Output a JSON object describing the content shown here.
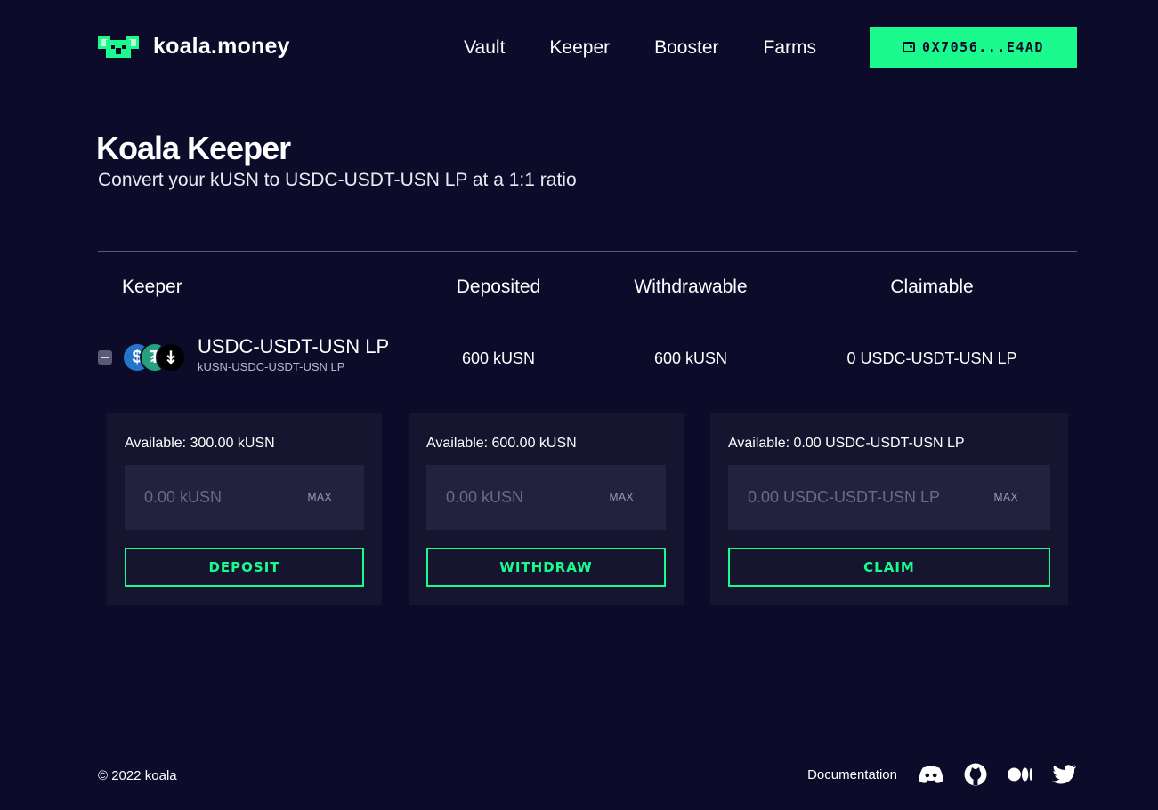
{
  "header": {
    "logo_text": "koala.money",
    "nav": [
      "Vault",
      "Keeper",
      "Booster",
      "Farms"
    ],
    "wallet_label": "0X7056...E4AD"
  },
  "page": {
    "title": "Koala Keeper",
    "subtitle": "Convert your kUSN to USDC-USDT-USN LP at a 1:1 ratio"
  },
  "table": {
    "headers": [
      "Keeper",
      "Deposited",
      "Withdrawable",
      "Claimable"
    ],
    "row": {
      "name": "USDC-USDT-USN LP",
      "subname": "kUSN-USDC-USDT-USN LP",
      "deposited": "600 kUSN",
      "withdrawable": "600 kUSN",
      "claimable": "0 USDC-USDT-USN LP"
    }
  },
  "panels": [
    {
      "available": "Available: 300.00 kUSN",
      "placeholder": "0.00 kUSN",
      "max_label": "MAX",
      "action_label": "DEPOSIT"
    },
    {
      "available": "Available: 600.00 kUSN",
      "placeholder": "0.00 kUSN",
      "max_label": "MAX",
      "action_label": "WITHDRAW"
    },
    {
      "available": "Available: 0.00 USDC-USDT-USN LP",
      "placeholder": "0.00 USDC-USDT-USN LP",
      "max_label": "MAX",
      "action_label": "CLAIM"
    }
  ],
  "footer": {
    "copyright": "© 2022 koala",
    "doc_link": "Documentation",
    "socials": [
      "discord-icon",
      "github-icon",
      "medium-icon",
      "twitter-icon"
    ]
  },
  "colors": {
    "background": "#0c0c2a",
    "accent": "#1bfa8d",
    "panel": "#15152f",
    "input": "#22223e"
  }
}
